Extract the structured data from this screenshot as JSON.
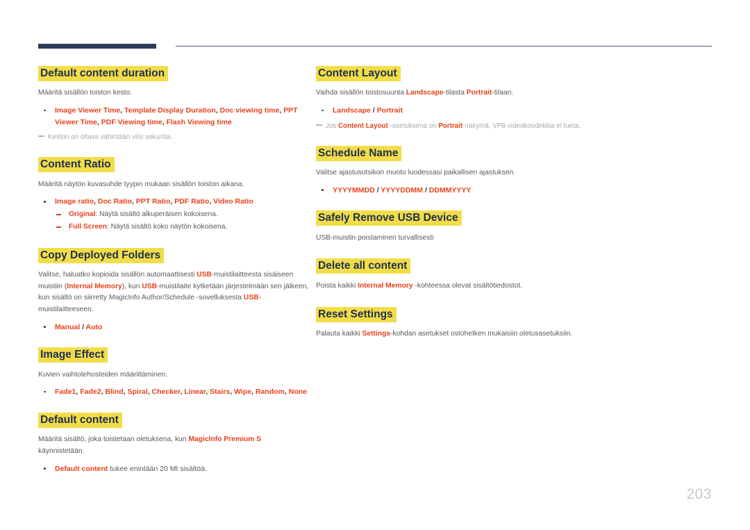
{
  "page": {
    "number": "203"
  },
  "left_column": [
    {
      "heading": "Default content duration",
      "intro": "Määritä sisällön toiston kesto.",
      "bullets": [
        {
          "parts": [
            {
              "t": "Image Viewer Time",
              "s": "kw"
            },
            {
              "t": ", ",
              "s": "sep"
            },
            {
              "t": "Template Display Duration",
              "s": "kw"
            },
            {
              "t": ", ",
              "s": "sep"
            },
            {
              "t": "Doc viewing time",
              "s": "kw"
            },
            {
              "t": ", ",
              "s": "sep"
            },
            {
              "t": "PPT Viewer Time",
              "s": "kw"
            },
            {
              "t": ", ",
              "s": "sep"
            },
            {
              "t": "PDF Viewing time",
              "s": "kw"
            },
            {
              "t": ", ",
              "s": "sep"
            },
            {
              "t": "Flash Viewing time",
              "s": "kw"
            }
          ]
        }
      ],
      "note": [
        {
          "t": "Keston on oltava vähintään viisi sekuntia.",
          "s": "plain"
        }
      ]
    },
    {
      "heading": "Content Ratio",
      "intro": "Määritä näytön kuvasuhde tyypin mukaan sisällön toiston aikana.",
      "bullets": [
        {
          "parts": [
            {
              "t": "Image ratio",
              "s": "kw"
            },
            {
              "t": ", ",
              "s": "sep"
            },
            {
              "t": "Doc Ratio",
              "s": "kw"
            },
            {
              "t": ", ",
              "s": "sep"
            },
            {
              "t": "PPT Ratio",
              "s": "kw"
            },
            {
              "t": ", ",
              "s": "sep"
            },
            {
              "t": "PDF Ratio",
              "s": "kw"
            },
            {
              "t": ", ",
              "s": "sep"
            },
            {
              "t": "Video Ratio",
              "s": "kw"
            }
          ],
          "sub": [
            [
              {
                "t": "Original",
                "s": "kw"
              },
              {
                "t": ": Näytä sisältö alkuperäisen kokoisena.",
                "s": "plain"
              }
            ],
            [
              {
                "t": "Full Screen",
                "s": "kw"
              },
              {
                "t": ": Näytä sisältö koko näytön kokoisena.",
                "s": "plain"
              }
            ]
          ]
        }
      ]
    },
    {
      "heading": "Copy Deployed Folders",
      "intro_parts": [
        {
          "t": "Valitse, haluatko kopioida sisällön automaattisesti ",
          "s": "plain"
        },
        {
          "t": "USB",
          "s": "kw"
        },
        {
          "t": "-muistilaitteesta sisäiseen muistiin (",
          "s": "plain"
        },
        {
          "t": "Internal Memory",
          "s": "kw"
        },
        {
          "t": "), kun ",
          "s": "plain"
        },
        {
          "t": "USB",
          "s": "kw"
        },
        {
          "t": "-muistilaite kytketään järjestelmään sen jälkeen, kun sisältö on siirretty MagicInfo Author/Schedule -sovelluksesta ",
          "s": "plain"
        },
        {
          "t": "USB",
          "s": "kw"
        },
        {
          "t": "-muistilaitteeseen.",
          "s": "plain"
        }
      ],
      "bullets": [
        {
          "parts": [
            {
              "t": "Manual",
              "s": "kw"
            },
            {
              "t": " / ",
              "s": "sep"
            },
            {
              "t": "Auto",
              "s": "kw"
            }
          ]
        }
      ]
    },
    {
      "heading": "Image Effect",
      "intro": "Kuvien vaihtotehosteiden määrittäminen.",
      "bullets": [
        {
          "parts": [
            {
              "t": "Fade1",
              "s": "kw"
            },
            {
              "t": ", ",
              "s": "sep"
            },
            {
              "t": "Fade2",
              "s": "kw"
            },
            {
              "t": ", ",
              "s": "sep"
            },
            {
              "t": "Blind",
              "s": "kw"
            },
            {
              "t": ", ",
              "s": "sep"
            },
            {
              "t": "Spiral",
              "s": "kw"
            },
            {
              "t": ", ",
              "s": "sep"
            },
            {
              "t": "Checker",
              "s": "kw"
            },
            {
              "t": ", ",
              "s": "sep"
            },
            {
              "t": "Linear",
              "s": "kw"
            },
            {
              "t": ", ",
              "s": "sep"
            },
            {
              "t": "Stairs",
              "s": "kw"
            },
            {
              "t": ", ",
              "s": "sep"
            },
            {
              "t": "Wipe",
              "s": "kw"
            },
            {
              "t": ", ",
              "s": "sep"
            },
            {
              "t": "Random",
              "s": "kw"
            },
            {
              "t": ", ",
              "s": "sep"
            },
            {
              "t": "None",
              "s": "kw"
            }
          ]
        }
      ]
    },
    {
      "heading": "Default content",
      "intro_parts": [
        {
          "t": "Määritä sisältö, joka toistetaan oletuksena, kun ",
          "s": "plain"
        },
        {
          "t": "MagicInfo Premium S",
          "s": "kw"
        },
        {
          "t": " käynnistetään.",
          "s": "plain"
        }
      ],
      "bullets": [
        {
          "parts": [
            {
              "t": "Default content",
              "s": "kw"
            },
            {
              "t": " tukee enintään 20 Mt sisältöä.",
              "s": "plain"
            }
          ]
        }
      ]
    }
  ],
  "right_column": [
    {
      "heading": "Content Layout",
      "intro_parts": [
        {
          "t": "Vaihda sisällön toistosuunta ",
          "s": "plain"
        },
        {
          "t": "Landscape",
          "s": "kw"
        },
        {
          "t": "-tilasta ",
          "s": "plain"
        },
        {
          "t": "Portrait",
          "s": "kw"
        },
        {
          "t": "-tilaan.",
          "s": "plain"
        }
      ],
      "bullets": [
        {
          "parts": [
            {
              "t": "Landscape",
              "s": "kw"
            },
            {
              "t": " / ",
              "s": "sep"
            },
            {
              "t": "Portrait",
              "s": "kw"
            }
          ]
        }
      ],
      "note": [
        {
          "t": "Jos ",
          "s": "plain"
        },
        {
          "t": "Content Layout",
          "s": "kw"
        },
        {
          "t": " -asetuksena on ",
          "s": "plain"
        },
        {
          "t": "Portrait",
          "s": "kw"
        },
        {
          "t": "-näkymä, VP8-videokoodekkia ei tueta.",
          "s": "plain"
        }
      ]
    },
    {
      "heading": "Schedule Name",
      "intro": "Valitse ajastusotsikon muoto luodessasi paikallisen ajastuksen.",
      "bullets": [
        {
          "parts": [
            {
              "t": "YYYYMMDD",
              "s": "kw"
            },
            {
              "t": " / ",
              "s": "sep"
            },
            {
              "t": "YYYYDDMM",
              "s": "kw"
            },
            {
              "t": " / ",
              "s": "sep"
            },
            {
              "t": "DDMMYYYY",
              "s": "kw"
            }
          ]
        }
      ]
    },
    {
      "heading": "Safely Remove USB Device",
      "intro": "USB-muistin poistaminen turvallisesti",
      "bullets": []
    },
    {
      "heading": "Delete all content",
      "intro_parts": [
        {
          "t": "Poista kaikki ",
          "s": "plain"
        },
        {
          "t": "Internal Memory",
          "s": "kw"
        },
        {
          "t": " -kohteessa olevat sisältötiedostot.",
          "s": "plain"
        }
      ],
      "bullets": []
    },
    {
      "heading": "Reset Settings",
      "intro_parts": [
        {
          "t": "Palauta kaikki ",
          "s": "plain"
        },
        {
          "t": "Settings",
          "s": "kw"
        },
        {
          "t": "-kohdan asetukset ostohetken mukaisiin oletusasetuksiin.",
          "s": "plain"
        }
      ],
      "bullets": []
    }
  ],
  "colors": {
    "heading_text": "#21304e",
    "highlight": "#f2dd49",
    "keyword": "#e8421b",
    "body_text": "#58585a",
    "note_text": "#a9a9ac",
    "rule_thick": "#2e3b5b",
    "rule_thin": "#4b5173",
    "page_number": "#c9c9cc"
  }
}
